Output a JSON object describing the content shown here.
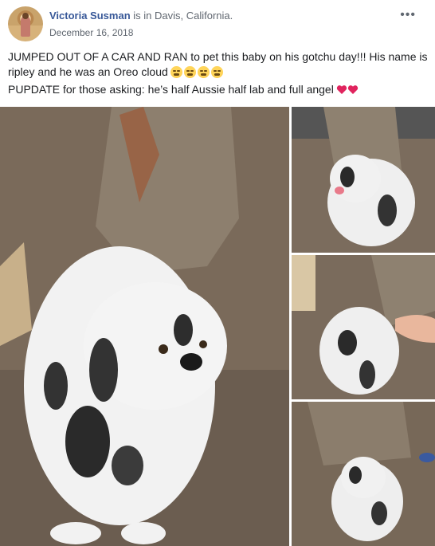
{
  "post": {
    "author": "Victoria Susman",
    "location_phrase": " is in Davis, California.",
    "date": "December 16, 2018",
    "more_label": "•••",
    "text_line1": "JUMPED OUT OF A CAR AND RAN to pet this baby on his gotchu day!!! His name is ripley and he was an Oreo cloud",
    "text_line2": "PUPDATE for those asking: he’s half Aussie half lab and full angel",
    "emoji_line1": [
      "weary-face",
      "weary-face",
      "weary-face",
      "weary-face"
    ],
    "emoji_line2": [
      "heart",
      "heart"
    ]
  },
  "photos": [
    {
      "name": "main-photo",
      "subject": "merle puppy sitting on dirt near tree"
    },
    {
      "name": "photo-2",
      "subject": "puppy with tongue out"
    },
    {
      "name": "photo-3",
      "subject": "hand petting puppy"
    },
    {
      "name": "photo-4",
      "subject": "puppy sitting near tree"
    }
  ],
  "colors": {
    "link": "#385898",
    "meta": "#606770",
    "text": "#1c1e21",
    "heart": "#e0245e"
  }
}
